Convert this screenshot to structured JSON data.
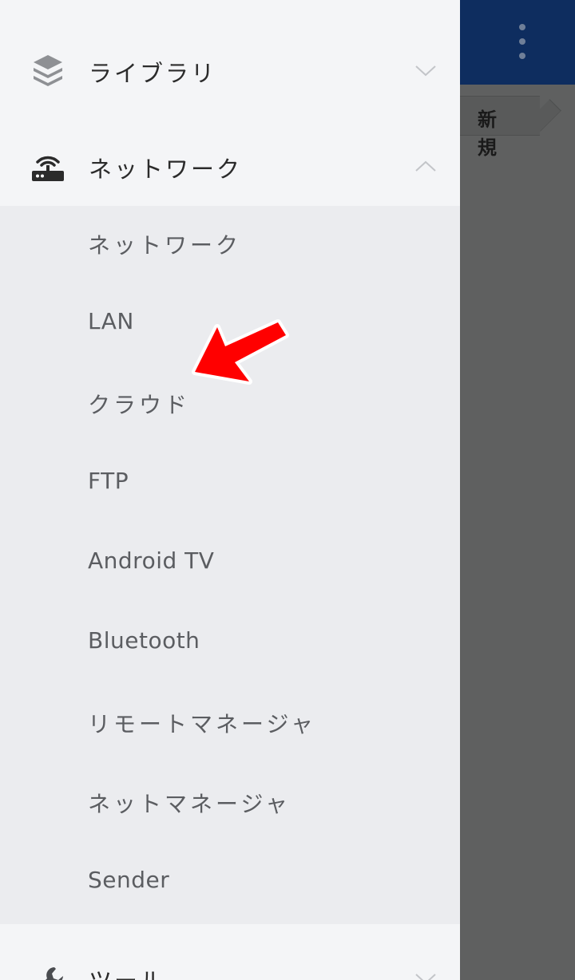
{
  "background": {
    "breadcrumb_new": "新規"
  },
  "drawer": {
    "groups": [
      {
        "label": "ライブラリ",
        "icon": "layers-icon",
        "expanded": false
      },
      {
        "label": "ネットワーク",
        "icon": "router-icon",
        "expanded": true
      },
      {
        "label": "ツール",
        "icon": "wrench-icon",
        "expanded": false
      }
    ],
    "network_items": [
      {
        "label": "ネットワーク"
      },
      {
        "label": "LAN"
      },
      {
        "label": "クラウド"
      },
      {
        "label": "FTP"
      },
      {
        "label": "Android TV"
      },
      {
        "label": "Bluetooth"
      },
      {
        "label": "リモートマネージャ"
      },
      {
        "label": "ネットマネージャ"
      },
      {
        "label": "Sender"
      }
    ]
  },
  "colors": {
    "topbar": "#0e2d5f",
    "drawer_bg": "#f4f5f7",
    "submenu_bg": "#ebecef",
    "annotation_arrow": "#ff0000"
  }
}
